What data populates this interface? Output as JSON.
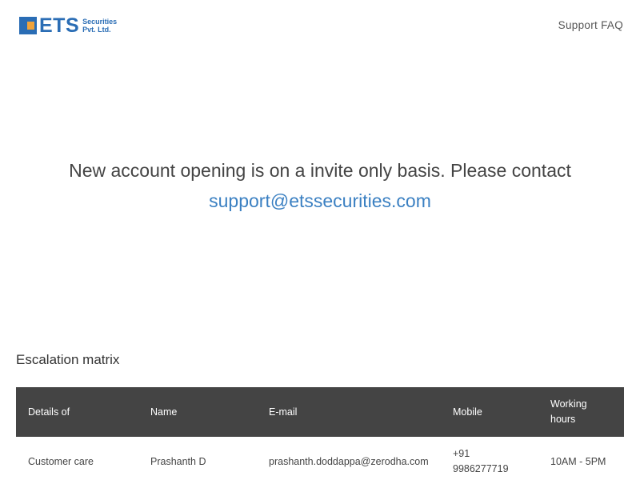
{
  "header": {
    "logo_text": "ETS",
    "logo_sub_line1": "Securities",
    "logo_sub_line2": "Pvt. Ltd.",
    "nav_link": "Support FAQ"
  },
  "main": {
    "message": "New account opening is on a invite only basis. Please contact",
    "email": "support@etssecurities.com"
  },
  "escalation": {
    "title": "Escalation matrix",
    "columns": [
      "Details of",
      "Name",
      "E-mail",
      "Mobile",
      "Working",
      "hours"
    ],
    "rows": [
      {
        "details": "Customer care",
        "name": "Prashanth D",
        "email": "prashanth.doddappa@zerodha.com",
        "mobile_line1": "+91",
        "mobile_line2": "9986277719",
        "hours": "10AM - 5PM"
      }
    ]
  },
  "colors": {
    "brand_blue": "#2a6db5",
    "brand_orange": "#f1a33a",
    "link_blue": "#3b80c2",
    "table_header_bg": "#444444"
  }
}
